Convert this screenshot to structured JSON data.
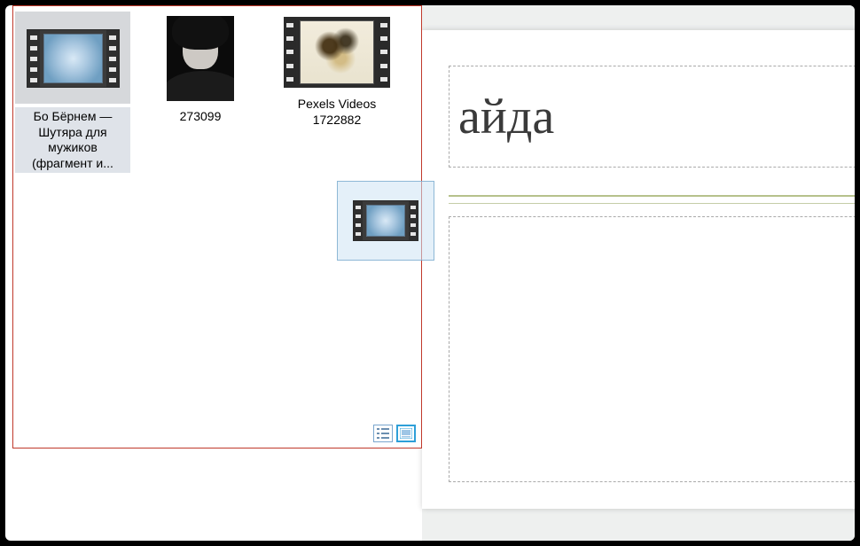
{
  "slide": {
    "title_fragment": "айда"
  },
  "file_browser": {
    "items": [
      {
        "label": "Бо Бёрнем — Шутяра для мужиков (фрагмент и...",
        "kind": "video",
        "selected": true
      },
      {
        "label": "273099",
        "kind": "image",
        "selected": false
      },
      {
        "label": "Pexels Videos 1722882",
        "kind": "video",
        "selected": false
      }
    ],
    "view_modes": {
      "list_label": "list-view",
      "thumbs_label": "thumbnail-view",
      "active": "thumbnail"
    }
  },
  "drag": {
    "dragging_item_index": 0
  }
}
